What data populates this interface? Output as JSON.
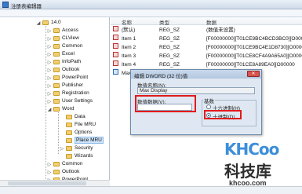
{
  "window": {
    "title": "注册表编辑器"
  },
  "tree": {
    "items": [
      {
        "label": "14.0",
        "expander": "◢"
      },
      {
        "label": "Access",
        "expander": "▷"
      },
      {
        "label": "CLView",
        "expander": "▷"
      },
      {
        "label": "Common",
        "expander": "▷"
      },
      {
        "label": "Excel",
        "expander": "▷"
      },
      {
        "label": "InfoPath",
        "expander": "▷"
      },
      {
        "label": "Outlook",
        "expander": "▷"
      },
      {
        "label": "PowerPoint",
        "expander": "▷"
      },
      {
        "label": "Publisher",
        "expander": "▷"
      },
      {
        "label": "Registration",
        "expander": "▷"
      },
      {
        "label": "User Settings",
        "expander": "▷"
      },
      {
        "label": "Word",
        "expander": "◢"
      },
      {
        "label": "Data",
        "expander": ""
      },
      {
        "label": "File MRU",
        "expander": ""
      },
      {
        "label": "Options",
        "expander": ""
      },
      {
        "label": "Place MRU",
        "expander": ""
      },
      {
        "label": "Security",
        "expander": "▷"
      },
      {
        "label": "Wizards",
        "expander": ""
      },
      {
        "label": "Common",
        "expander": "▷"
      },
      {
        "label": "Outlook",
        "expander": "▷"
      },
      {
        "label": "PowerPoint",
        "expander": "▷"
      }
    ]
  },
  "list": {
    "headers": {
      "name": "名称",
      "type": "类型",
      "data": "数据"
    },
    "rows": [
      {
        "name": "(默认)",
        "type": "REG_SZ",
        "data": "(数值未设置)",
        "icon": "string-value-icon"
      },
      {
        "name": "Item 1",
        "type": "REG_SZ",
        "data": "[F00000000][T01CE9BC4BCD3BC0][O00000",
        "icon": "string-value-icon"
      },
      {
        "name": "Item 2",
        "type": "REG_SZ",
        "data": "[F00000000][T01CE9BC4E1D8730][O00000",
        "icon": "string-value-icon"
      },
      {
        "name": "Item 3",
        "type": "REG_SZ",
        "data": "[F00000000][T01CE8CF4A9A65A0][O00000",
        "icon": "string-value-icon"
      },
      {
        "name": "Item 4",
        "type": "REG_SZ",
        "data": "[F00000000][T01CE8A89EA0][O00000",
        "icon": "string-value-icon"
      },
      {
        "name": "Max",
        "type": "",
        "data": "",
        "icon": "binary-value-icon"
      }
    ]
  },
  "dialog": {
    "title": "编辑 DWORD (32 位)值",
    "close_label": "✕",
    "value_name_label": "数值名称(N):",
    "value_name": "Max Display",
    "value_data_label": "数值数据(V):",
    "value_data": "",
    "base_label": "基数",
    "hex_label": "十六进制(H)",
    "dec_label": "十进制(D)",
    "selected_base": "decimal",
    "accent_color": "#e21a1a"
  },
  "watermark": {
    "logo": "KHCoo",
    "brand": "科技库",
    "url": "khcoo.com"
  }
}
